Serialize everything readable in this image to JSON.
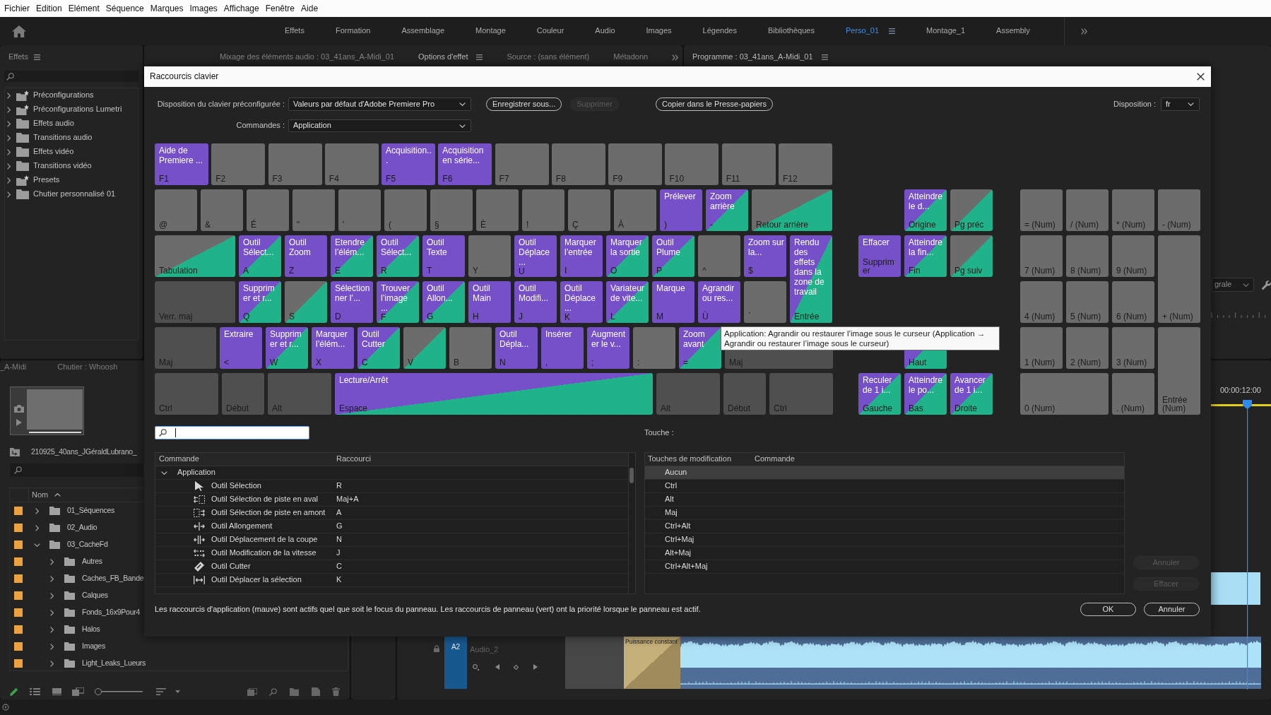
{
  "menu_bar": [
    "Fichier",
    "Edition",
    "Elément",
    "Séquence",
    "Marques",
    "Images",
    "Affichage",
    "Fenêtre",
    "Aide"
  ],
  "workspaces": [
    {
      "label": "Effets",
      "selected": false
    },
    {
      "label": "Formation",
      "selected": false
    },
    {
      "label": "Assemblage",
      "selected": false
    },
    {
      "label": "Montage",
      "selected": false
    },
    {
      "label": "Couleur",
      "selected": false
    },
    {
      "label": "Audio",
      "selected": false
    },
    {
      "label": "Images",
      "selected": false
    },
    {
      "label": "Légendes",
      "selected": false
    },
    {
      "label": "Bibliothèques",
      "selected": false
    },
    {
      "label": "Perso_01",
      "selected": true
    },
    {
      "label": "Montage_1",
      "selected": false
    },
    {
      "label": "Assembly",
      "selected": false
    }
  ],
  "effects_panel": {
    "title": "Effets",
    "items": [
      {
        "label": "Préconfigurations",
        "kind": "preset"
      },
      {
        "label": "Préconfigurations Lumetri",
        "kind": "preset"
      },
      {
        "label": "Effets audio",
        "kind": "folder"
      },
      {
        "label": "Transitions audio",
        "kind": "folder"
      },
      {
        "label": "Effets vidéo",
        "kind": "folder"
      },
      {
        "label": "Transitions vidéo",
        "kind": "folder"
      },
      {
        "label": "Presets",
        "kind": "preset"
      },
      {
        "label": "Chutier personnalisé 01",
        "kind": "folder"
      }
    ]
  },
  "source_panel": {
    "tabs": [
      {
        "label": "Mixage des éléments audio : 03_41ans_A-Midi_01",
        "selected": false
      },
      {
        "label": "Options d'effet",
        "selected": true
      },
      {
        "label": "Source : (sans élément)",
        "selected": false
      },
      {
        "label": "Métadonn",
        "selected": false
      }
    ]
  },
  "program_panel": {
    "tabs": [
      {
        "label": "Programme : 03_41ans_A-Midi_01",
        "selected": true
      }
    ],
    "zoom_menu": "grale"
  },
  "project_panel": {
    "tabs": [
      "_A-Midi",
      "Chutier : Whoosh"
    ],
    "project_name": "210925_40ans_JGéraldLubrano_",
    "column": "Nom",
    "items": [
      {
        "name": "01_Séquences",
        "expanded": false
      },
      {
        "name": "02_Audio",
        "expanded": false
      },
      {
        "name": "03_CacheFd",
        "expanded": true,
        "children": [
          {
            "name": "Autres",
            "expanded": false
          },
          {
            "name": "Caches_FB_Bande",
            "expanded": false
          },
          {
            "name": "Calques",
            "expanded": false
          },
          {
            "name": "Fonds_16x9Pour4",
            "expanded": false
          },
          {
            "name": "Halos",
            "expanded": false
          },
          {
            "name": "Images",
            "expanded": false
          },
          {
            "name": "Light_Leaks_Lueurs",
            "expanded": false
          }
        ]
      }
    ],
    "zoom_slider": {
      "level": 0
    }
  },
  "timeline": {
    "timecode": "00:00:12:00",
    "track_target": "A2",
    "track_name": "Audio_2",
    "transition": "Puissance constant"
  },
  "dialog": {
    "title": "Raccourcis clavier",
    "preset": {
      "label": "Disposition du clavier préconfigurée :",
      "value": "Valeurs par défaut d'Adobe Premiere Pro"
    },
    "actions": [
      {
        "label": "Enregistrer sous...",
        "disabled": false
      },
      {
        "label": "Supprimer",
        "disabled": true
      },
      {
        "label": "Copier dans le Presse-papiers",
        "disabled": false
      }
    ],
    "layout": {
      "label": "Disposition :",
      "value": "fr"
    },
    "commands": {
      "label": "Commandes :",
      "value": "Application"
    },
    "keyboard": {
      "main_rows": [
        [
          {
            "label": "F1",
            "command": "Aide de Premiere ...",
            "kind": "app"
          },
          {
            "label": "F2",
            "kind": "plain"
          },
          {
            "label": "F3",
            "kind": "plain"
          },
          {
            "label": "F4",
            "kind": "plain"
          },
          {
            "label": "F5",
            "command": "Acquisition...",
            "kind": "app"
          },
          {
            "label": "F6",
            "command": "Acquisition en série...",
            "kind": "app"
          },
          {
            "label": "F7",
            "kind": "plain"
          },
          {
            "label": "F8",
            "kind": "plain"
          },
          {
            "label": "F9",
            "kind": "plain"
          },
          {
            "label": "F10",
            "kind": "plain"
          },
          {
            "label": "F11",
            "kind": "plain"
          },
          {
            "label": "F12",
            "kind": "plain"
          }
        ],
        [
          {
            "label": "@",
            "kind": "plain"
          },
          {
            "label": "&",
            "kind": "plain"
          },
          {
            "label": "É",
            "kind": "plain"
          },
          {
            "label": "\"",
            "kind": "plain"
          },
          {
            "label": "'",
            "kind": "plain"
          },
          {
            "label": "(",
            "kind": "plain"
          },
          {
            "label": "§",
            "kind": "plain"
          },
          {
            "label": "È",
            "kind": "plain"
          },
          {
            "label": "!",
            "kind": "plain"
          },
          {
            "label": "Ç",
            "kind": "plain"
          },
          {
            "label": "À",
            "kind": "plain"
          },
          {
            "label": ")",
            "command": "Prélever",
            "kind": "app"
          },
          {
            "label": "-",
            "command": "Zoom arrière",
            "kind": "both"
          },
          {
            "label": "Retour arrière",
            "kind": "panel"
          }
        ],
        [
          {
            "label": "Tabulation",
            "kind": "panel"
          },
          {
            "label": "A",
            "command": "Outil Sélect...",
            "kind": "both"
          },
          {
            "label": "Z",
            "command": "Outil Zoom",
            "kind": "app"
          },
          {
            "label": "E",
            "command": "Etendre l’élém...",
            "kind": "both"
          },
          {
            "label": "R",
            "command": "Outil Sélect...",
            "kind": "both"
          },
          {
            "label": "T",
            "command": "Outil Texte",
            "kind": "app"
          },
          {
            "label": "Y",
            "kind": "plain"
          },
          {
            "label": "U",
            "command": "Outil Déplace ...",
            "kind": "app"
          },
          {
            "label": "I",
            "command": "Marquer l’entrée",
            "kind": "app"
          },
          {
            "label": "O",
            "command": "Marquer la sortie",
            "kind": "both"
          },
          {
            "label": "P",
            "command": "Outil Plume",
            "kind": "both"
          },
          {
            "label": "^",
            "kind": "plain"
          },
          {
            "label": "$",
            "command": "Zoom sur la...",
            "kind": "app"
          },
          {
            "label": "Entrée",
            "command": "Rendu des effets dans la zone de travail",
            "kind": "both"
          }
        ],
        [
          {
            "label": "Verr. maj",
            "kind": "modifier"
          },
          {
            "label": "Q",
            "command": "Supprimer et r...",
            "kind": "both"
          },
          {
            "label": "S",
            "kind": "panel"
          },
          {
            "label": "D",
            "command": "Sélectionner l’...",
            "kind": "app"
          },
          {
            "label": "F",
            "command": "Trouver l’image ...",
            "kind": "both"
          },
          {
            "label": "G",
            "command": "Outil Allon...",
            "kind": "both"
          },
          {
            "label": "H",
            "command": "Outil Main",
            "kind": "app"
          },
          {
            "label": "J",
            "command": "Outil Modifi...",
            "kind": "app"
          },
          {
            "label": "K",
            "command": "Outil Déplace ...",
            "kind": "app"
          },
          {
            "label": "L",
            "command": "Variateur de vite...",
            "kind": "both"
          },
          {
            "label": "M",
            "command": "Marque",
            "kind": "app"
          },
          {
            "label": "Ù",
            "command": "Agrandir ou res...",
            "kind": "app"
          },
          {
            "label": "`",
            "kind": "plain"
          }
        ],
        [
          {
            "label": "Maj",
            "kind": "modifier"
          },
          {
            "label": "<",
            "command": "Extraire",
            "kind": "app"
          },
          {
            "label": "W",
            "command": "Supprimer et r...",
            "kind": "both"
          },
          {
            "label": "X",
            "command": "Marquer l’élém...",
            "kind": "app"
          },
          {
            "label": "C",
            "command": "Outil Cutter",
            "kind": "both"
          },
          {
            "label": "V",
            "kind": "panel"
          },
          {
            "label": "B",
            "kind": "plain"
          },
          {
            "label": "N",
            "command": "Outil Dépla...",
            "kind": "app"
          },
          {
            "label": ",",
            "command": "Insérer",
            "kind": "app"
          },
          {
            "label": ";",
            "command": "Augmenter le v...",
            "kind": "app"
          },
          {
            "label": ":",
            "kind": "plain"
          },
          {
            "label": "=",
            "command": "Zoom avant",
            "kind": "both"
          },
          {
            "label": "Maj",
            "kind": "modifier"
          }
        ],
        [
          {
            "label": "Ctrl",
            "kind": "modifier"
          },
          {
            "label": "Début",
            "kind": "modifier"
          },
          {
            "label": "Alt",
            "kind": "modifier"
          },
          {
            "label": "Espace",
            "command": "Lecture/Arrêt",
            "kind": "both"
          },
          {
            "label": "Alt",
            "kind": "modifier"
          },
          {
            "label": "Début",
            "kind": "modifier"
          },
          {
            "label": "Ctrl",
            "kind": "modifier"
          }
        ]
      ],
      "navigation_keys": [
        {
          "label": "Origine",
          "command": "Atteindre le d...",
          "kind": "both"
        },
        {
          "label": "Pg préc",
          "kind": "panel"
        },
        {
          "label": "Supprimer",
          "command": "Effacer",
          "kind": "app"
        },
        {
          "label": "Fin",
          "command": "Atteindre la fin...",
          "kind": "both"
        },
        {
          "label": "Pg suiv",
          "kind": "panel"
        },
        {
          "label": "Haut",
          "kind": "both"
        },
        {
          "label": "Gauche",
          "command": "Reculer de 1 i...",
          "kind": "both"
        },
        {
          "label": "Bas",
          "command": "Atteindre le po...",
          "kind": "both"
        },
        {
          "label": "Droite",
          "command": "Avancer de 1 i...",
          "kind": "both"
        }
      ],
      "numpad_keys": [
        {
          "label": "= (Num)",
          "kind": "plain"
        },
        {
          "label": "/ (Num)",
          "kind": "plain"
        },
        {
          "label": "* (Num)",
          "kind": "plain"
        },
        {
          "label": "- (Num)",
          "kind": "plain"
        },
        {
          "label": "7 (Num)",
          "kind": "plain"
        },
        {
          "label": "8 (Num)",
          "kind": "plain"
        },
        {
          "label": "9 (Num)",
          "kind": "plain"
        },
        {
          "label": "4 (Num)",
          "kind": "plain"
        },
        {
          "label": "5 (Num)",
          "kind": "plain"
        },
        {
          "label": "6 (Num)",
          "kind": "plain"
        },
        {
          "label": "+ (Num)",
          "kind": "plain"
        },
        {
          "label": "1 (Num)",
          "kind": "plain"
        },
        {
          "label": "2 (Num)",
          "kind": "plain"
        },
        {
          "label": "3 (Num)",
          "kind": "plain"
        },
        {
          "label": "0 (Num)",
          "kind": "plain"
        },
        {
          "label": ". (Num)",
          "kind": "plain"
        },
        {
          "label": "Entrée (Num)",
          "kind": "plain"
        }
      ]
    },
    "tooltip": "Application: Agrandir ou restaurer l’image sous le curseur (Application → Agrandir ou restaurer l’image sous le curseur)",
    "key_label": "Touche :",
    "command_table": {
      "columns": [
        "Commande",
        "Raccourci"
      ],
      "group": "Application",
      "expanded": true,
      "rows": [
        {
          "command": "Outil Sélection",
          "shortcut": "R"
        },
        {
          "command": "Outil Sélection de piste en aval",
          "shortcut": "Maj+A"
        },
        {
          "command": "Outil Sélection de piste en amont",
          "shortcut": "A"
        },
        {
          "command": "Outil Allongement",
          "shortcut": "G"
        },
        {
          "command": "Outil Déplacement de la coupe",
          "shortcut": "N"
        },
        {
          "command": "Outil Modification de la vitesse",
          "shortcut": "J"
        },
        {
          "command": "Outil Cutter",
          "shortcut": "C"
        },
        {
          "command": "Outil Déplacer la sélection",
          "shortcut": "K"
        }
      ]
    },
    "modifier_table": {
      "columns": [
        "Touches de modification",
        "Commande"
      ],
      "rows": [
        {
          "modifiers": "Aucun",
          "selected": true
        },
        {
          "modifiers": "Ctrl",
          "selected": false
        },
        {
          "modifiers": "Alt",
          "selected": false
        },
        {
          "modifiers": "Maj",
          "selected": false
        },
        {
          "modifiers": "Ctrl+Alt",
          "selected": false
        },
        {
          "modifiers": "Ctrl+Maj",
          "selected": false
        },
        {
          "modifiers": "Alt+Maj",
          "selected": false
        },
        {
          "modifiers": "Ctrl+Alt+Maj",
          "selected": false
        }
      ]
    },
    "side_buttons": [
      {
        "label": "Annuler",
        "disabled": true
      },
      {
        "label": "Effacer",
        "disabled": true
      }
    ],
    "note": "Les raccourcis d'application (mauve) sont actifs quel que soit le focus du panneau. Les raccourcis de panneau (vert) ont la priorité lorsque le panneau est actif.",
    "buttons": [
      "OK",
      "Annuler"
    ]
  }
}
